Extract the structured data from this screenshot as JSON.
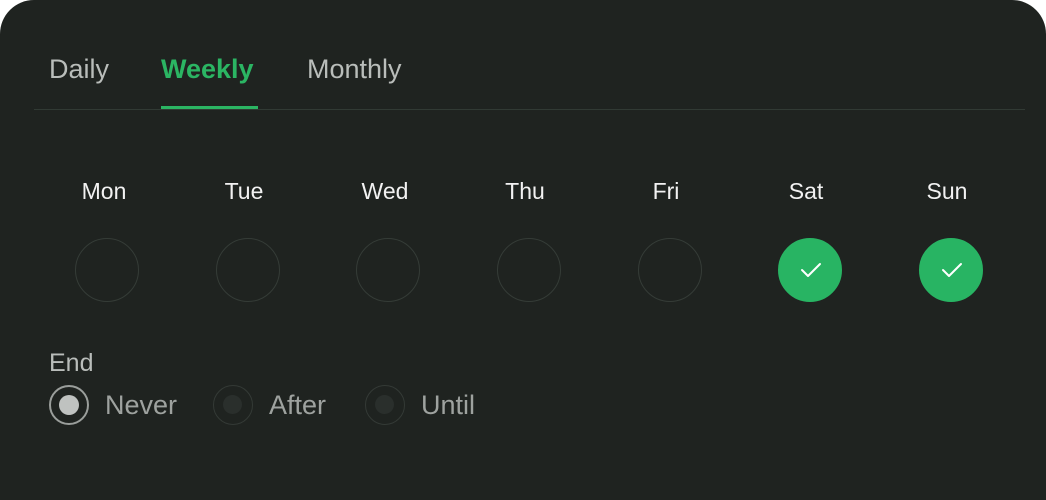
{
  "tabs": [
    {
      "label": "Daily",
      "active": false
    },
    {
      "label": "Weekly",
      "active": true
    },
    {
      "label": "Monthly",
      "active": false
    }
  ],
  "days": [
    {
      "label": "Mon",
      "checked": false
    },
    {
      "label": "Tue",
      "checked": false
    },
    {
      "label": "Wed",
      "checked": false
    },
    {
      "label": "Thu",
      "checked": false
    },
    {
      "label": "Fri",
      "checked": false
    },
    {
      "label": "Sat",
      "checked": true
    },
    {
      "label": "Sun",
      "checked": true
    }
  ],
  "end": {
    "label": "End",
    "options": [
      {
        "label": "Never",
        "selected": true
      },
      {
        "label": "After",
        "selected": false
      },
      {
        "label": "Until",
        "selected": false
      }
    ]
  },
  "colors": {
    "accent": "#2bb563",
    "panel_background": "#1f2320"
  },
  "icons": {
    "checked_day": "check-icon"
  }
}
